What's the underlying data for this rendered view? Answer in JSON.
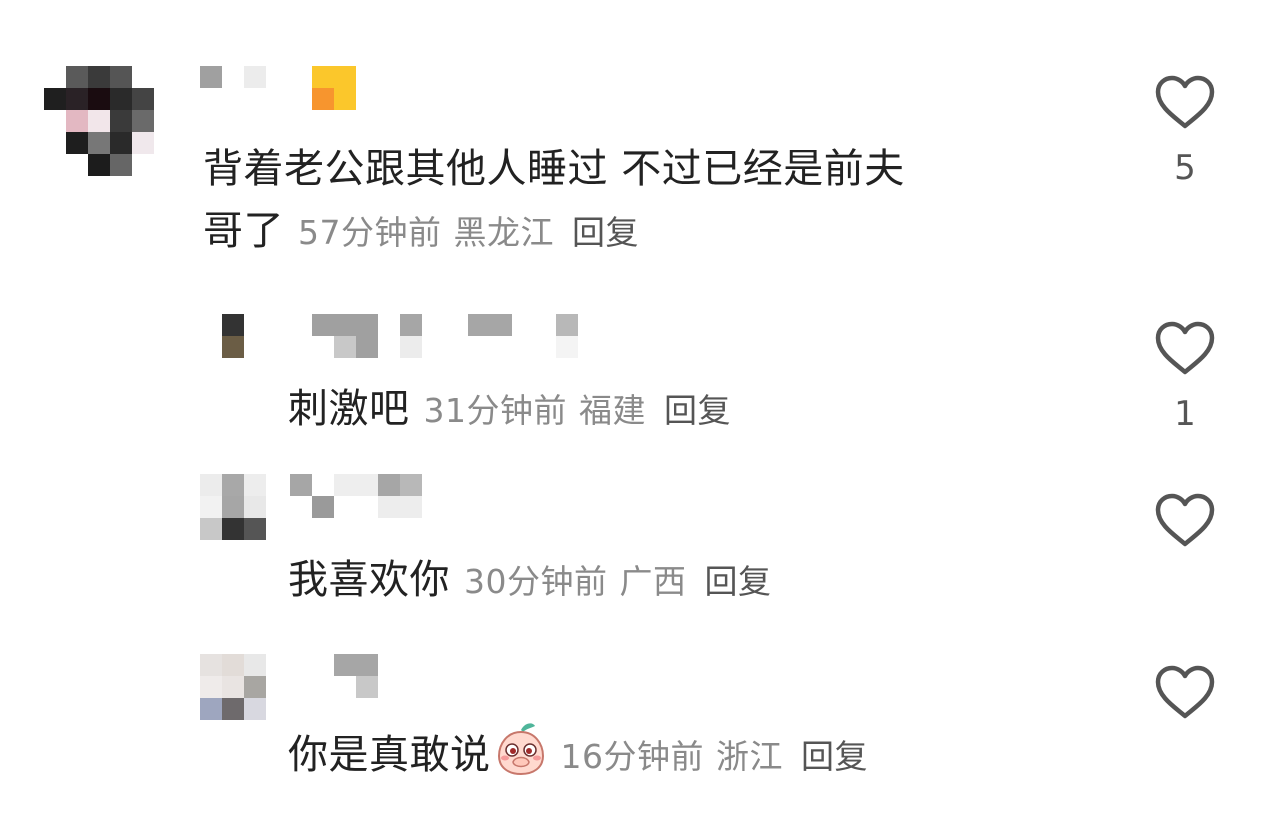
{
  "comments": [
    {
      "text": "背着老公跟其他人睡过 不过已经是前夫哥了",
      "text_line1": "背着老公跟其他人睡过 不过已经是前夫",
      "text_line2": "哥了",
      "time": "57分钟前",
      "location": "黑龙江",
      "reply_label": "回复",
      "likes": "5",
      "is_reply": false
    },
    {
      "text": "刺激吧",
      "time": "31分钟前",
      "location": "福建",
      "reply_label": "回复",
      "likes": "1",
      "is_reply": true
    },
    {
      "text": "我喜欢你",
      "time": "30分钟前",
      "location": "广西",
      "reply_label": "回复",
      "likes": "",
      "is_reply": true
    },
    {
      "text": "你是真敢说",
      "emoji": "peach-covering-mouth-emoji",
      "time": "16分钟前",
      "location": "浙江",
      "reply_label": "回复",
      "likes": "",
      "is_reply": true
    }
  ],
  "icons": {
    "like": "heart-outline-icon"
  },
  "colors": {
    "text": "#222222",
    "meta": "#8a8a8a",
    "icon": "#555555",
    "background": "#ffffff"
  }
}
